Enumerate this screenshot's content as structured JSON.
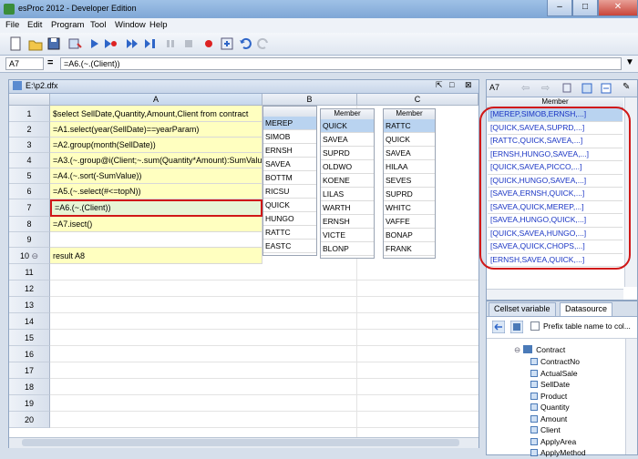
{
  "window": {
    "title": "esProc 2012 - Developer Edition"
  },
  "menu": [
    "File",
    "Edit",
    "Program",
    "Tool",
    "Window",
    "Help"
  ],
  "formula_bar": {
    "cell_ref": "A7",
    "eq": "=",
    "formula": "=A6.(~.(Client))"
  },
  "doc": {
    "path": "E:\\p2.dfx",
    "columns": [
      "A",
      "B",
      "C"
    ],
    "row_numbers": [
      "1",
      "2",
      "3",
      "4",
      "5",
      "6",
      "7",
      "8",
      "9",
      "10",
      "11",
      "12",
      "13",
      "14",
      "15",
      "16",
      "17",
      "18",
      "19",
      "20"
    ],
    "cells_a": [
      "$select SellDate,Quantity,Amount,Client from contract",
      "=A1.select(year(SellDate)==yearParam)",
      "=A2.group(month(SellDate))",
      "=A3.(~.group@i(Client;~.sum(Quantity*Amount):SumValue))",
      "=A4.(~.sort(-SumValue))",
      "=A5.(~.select(#<=topN))",
      "=A6.(~.(Client))",
      "=A7.isect()",
      "",
      "result A8"
    ]
  },
  "member_tables": [
    {
      "header": "",
      "items": [
        "MEREP",
        "SIMOB",
        "ERNSH",
        "SAVEA",
        "BOTTM",
        "RICSU",
        "QUICK",
        "HUNGO",
        "RATTC",
        "EASTC"
      ]
    },
    {
      "header": "Member",
      "items": [
        "QUICK",
        "SAVEA",
        "SUPRD",
        "OLDWO",
        "KOENE",
        "LILAS",
        "WARTH",
        "ERNSH",
        "VICTE",
        "BLONP"
      ]
    },
    {
      "header": "Member",
      "items": [
        "RATTC",
        "QUICK",
        "SAVEA",
        "HILAA",
        "SEVES",
        "SUPRD",
        "WHITC",
        "VAFFE",
        "BONAP",
        "FRANK"
      ]
    }
  ],
  "right_panel": {
    "cell_ref": "A7",
    "header": "Member",
    "items": [
      "[MEREP,SIMOB,ERNSH,...]",
      "[QUICK,SAVEA,SUPRD,...]",
      "[RATTC,QUICK,SAVEA,...]",
      "[ERNSH,HUNGO,SAVEA,...]",
      "[QUICK,SAVEA,PICCO,...]",
      "[QUICK,HUNGO,SAVEA,...]",
      "[SAVEA,ERNSH,QUICK,...]",
      "[SAVEA,QUICK,MEREP,...]",
      "[SAVEA,HUNGO,QUICK,...]",
      "[QUICK,SAVEA,HUNGO,...]",
      "[SAVEA,QUICK,CHOPS,...]",
      "[ERNSH,SAVEA,QUICK,...]"
    ]
  },
  "bottom_panel": {
    "tabs": [
      "Cellset variable",
      "Datasource"
    ],
    "checkbox_label": "Prefix table name to col...",
    "tree_root": "Contract",
    "fields": [
      "ContractNo",
      "ActualSale",
      "SellDate",
      "Product",
      "Quantity",
      "Amount",
      "Client",
      "ApplyArea",
      "ApplyMethod"
    ]
  },
  "colors": {
    "highlight_red": "#d01818",
    "cell_yellow": "#ffffc0",
    "selected_green": "#e7f5d5",
    "link_blue": "#1a35c4"
  }
}
